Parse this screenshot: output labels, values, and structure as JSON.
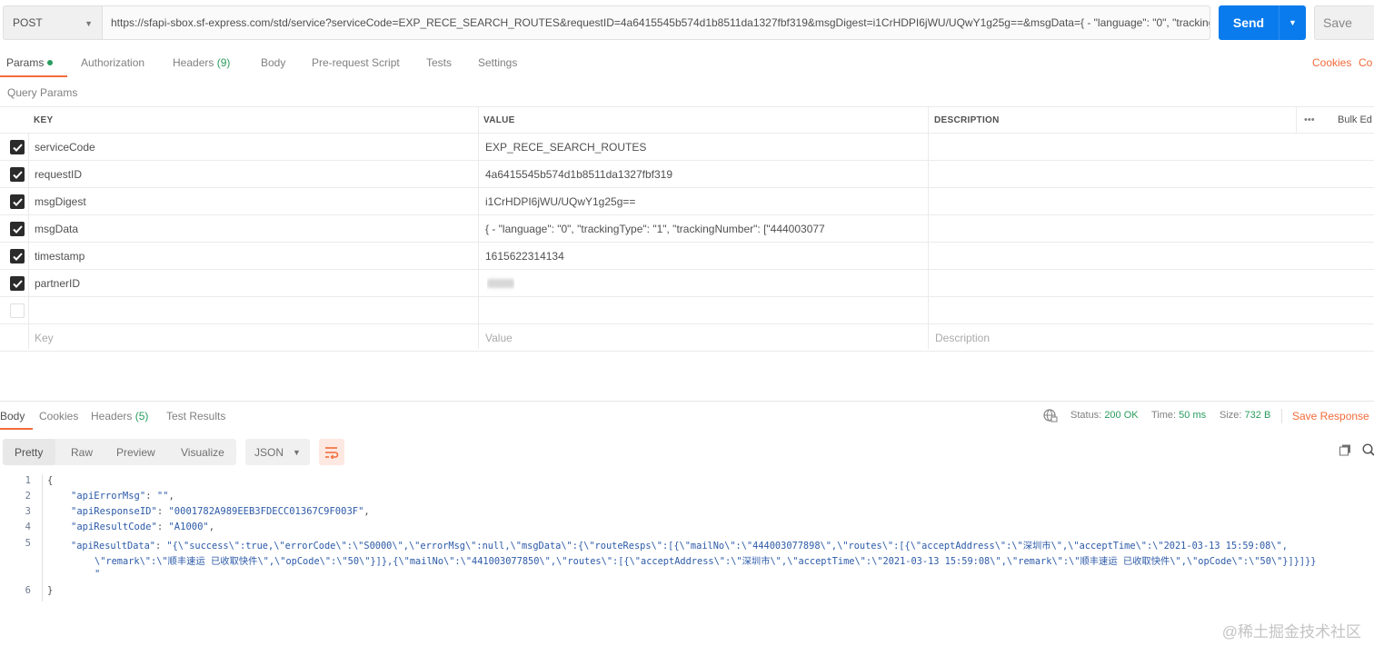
{
  "request": {
    "method": "POST",
    "url": "https://sfapi-sbox.sf-express.com/std/service?serviceCode=EXP_RECE_SEARCH_ROUTES&requestID=4a6415545b574d1b8511da1327fbf319&msgDigest=i1CrHDPI6jWU/UQwY1g25g==&msgData={ - \"language\": \"0\", \"trackingT...",
    "send_label": "Send",
    "save_label": "Save"
  },
  "request_tabs": {
    "params": "Params",
    "authorization": "Authorization",
    "headers": "Headers",
    "headers_count": "(9)",
    "body": "Body",
    "prerequest": "Pre-request Script",
    "tests": "Tests",
    "settings": "Settings",
    "cookies": "Cookies",
    "code": "Co"
  },
  "query_params": {
    "title": "Query Params",
    "columns": {
      "key": "KEY",
      "value": "VALUE",
      "description": "DESCRIPTION",
      "bulk_edit": "Bulk Ed",
      "more": "•••"
    },
    "rows": [
      {
        "key": "serviceCode",
        "value": "EXP_RECE_SEARCH_ROUTES"
      },
      {
        "key": "requestID",
        "value": "4a6415545b574d1b8511da1327fbf319"
      },
      {
        "key": "msgDigest",
        "value": "i1CrHDPI6jWU/UQwY1g25g=="
      },
      {
        "key": "msgData",
        "value": "{ - \"language\": \"0\", \"trackingType\": \"1\", \"trackingNumber\": [\"444003077"
      },
      {
        "key": "timestamp",
        "value": "1615622314134"
      },
      {
        "key": "partnerID",
        "value": ""
      }
    ],
    "placeholder": {
      "key": "Key",
      "value": "Value",
      "description": "Description"
    }
  },
  "response_tabs": {
    "body": "Body",
    "cookies": "Cookies",
    "headers": "Headers",
    "headers_count": "(5)",
    "test_results": "Test Results"
  },
  "response_status": {
    "status_label": "Status:",
    "status_value": "200 OK",
    "time_label": "Time:",
    "time_value": "50 ms",
    "size_label": "Size:",
    "size_value": "732 B",
    "save_response": "Save Response"
  },
  "view_modes": {
    "pretty": "Pretty",
    "raw": "Raw",
    "preview": "Preview",
    "visualize": "Visualize",
    "format": "JSON"
  },
  "response_body": {
    "line_numbers": [
      "1",
      "2",
      "3",
      "4",
      "5",
      "6"
    ],
    "open_brace": "{",
    "close_brace": "}",
    "l2_key": "\"apiErrorMsg\"",
    "l2_val": "\"\"",
    "l3_key": "\"apiResponseID\"",
    "l3_val": "\"0001782A989EEB3FDECC01367C9F003F\"",
    "l4_key": "\"apiResultCode\"",
    "l4_val": "\"A1000\"",
    "l5_key": "\"apiResultData\"",
    "l5_val_a": "\"{\\\"success\\\":true,\\\"errorCode\\\":\\\"S0000\\\",\\\"errorMsg\\\":null,\\\"msgData\\\":{\\\"routeResps\\\":[{\\\"mailNo\\\":\\\"444003077898\\\",\\\"routes\\\":[{\\\"acceptAddress\\\":\\\"深圳市\\\",\\\"acceptTime\\\":\\\"2021-03-13 15:59:08\\\",",
    "l5_val_b": "\\\"remark\\\":\\\"顺丰速运 已收取快件\\\",\\\"opCode\\\":\\\"50\\\"}]},{\\\"mailNo\\\":\\\"441003077850\\\",\\\"routes\\\":[{\\\"acceptAddress\\\":\\\"深圳市\\\",\\\"acceptTime\\\":\\\"2021-03-13 15:59:08\\\",\\\"remark\\\":\\\"顺丰速运 已收取快件\\\",\\\"opCode\\\":\\\"50\\\"}]}]}}",
    "l5_val_c": "\""
  },
  "watermark": "@稀土掘金技术社区"
}
